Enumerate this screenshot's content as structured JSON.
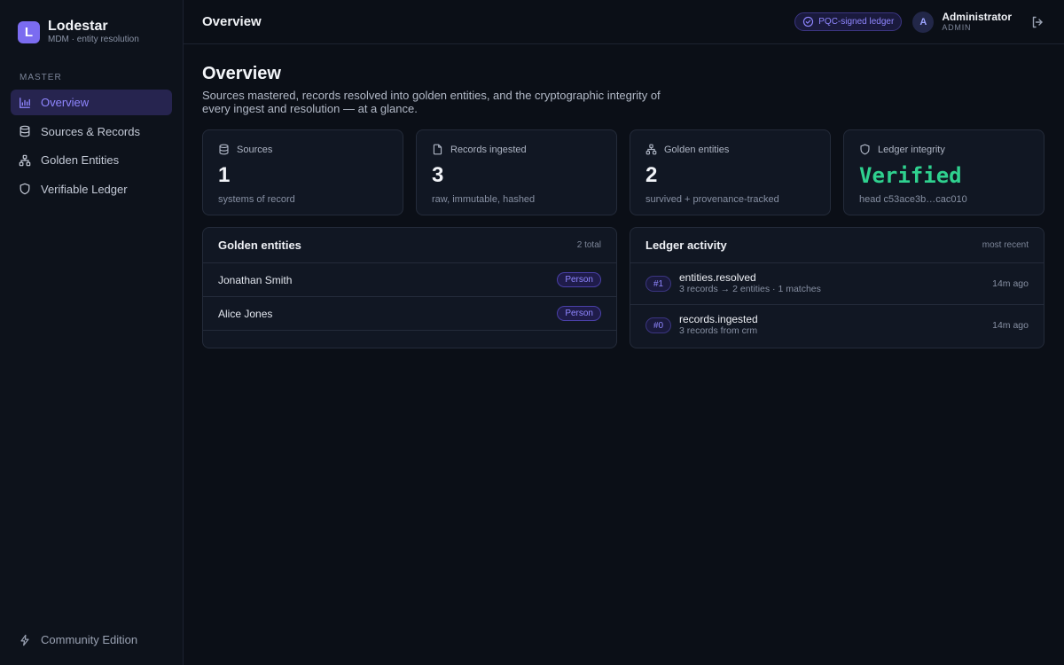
{
  "brand": {
    "logo_letter": "L",
    "name": "Lodestar",
    "subtitle": "MDM · entity resolution"
  },
  "sidebar": {
    "section_label": "MASTER",
    "items": [
      {
        "label": "Overview",
        "icon": "bar-chart-icon",
        "active": true
      },
      {
        "label": "Sources & Records",
        "icon": "database-icon",
        "active": false
      },
      {
        "label": "Golden Entities",
        "icon": "hierarchy-icon",
        "active": false
      },
      {
        "label": "Verifiable Ledger",
        "icon": "shield-icon",
        "active": false
      }
    ],
    "footer_label": "Community Edition",
    "footer_icon": "lightning-icon"
  },
  "topbar": {
    "title": "Overview",
    "badge_label": "PQC-signed ledger",
    "badge_icon": "check-circle-icon",
    "avatar_letter": "A",
    "user_name": "Administrator",
    "user_role": "ADMIN",
    "logout_icon": "logout-icon"
  },
  "page": {
    "title": "Overview",
    "description": "Sources mastered, records resolved into golden entities, and the cryptographic integrity of every ingest and resolution — at a glance."
  },
  "stats": [
    {
      "label": "Sources",
      "icon": "database-icon",
      "value": "1",
      "sub": "systems of record"
    },
    {
      "label": "Records ingested",
      "icon": "file-icon",
      "value": "3",
      "sub": "raw, immutable, hashed"
    },
    {
      "label": "Golden entities",
      "icon": "hierarchy-icon",
      "value": "2",
      "sub": "survived + provenance-tracked"
    },
    {
      "label": "Ledger integrity",
      "icon": "shield-icon",
      "value": "Verified",
      "sub": "head c53ace3b…cac010"
    }
  ],
  "golden_entities": {
    "title": "Golden entities",
    "meta": "2 total",
    "rows": [
      {
        "name": "Jonathan Smith",
        "type": "Person"
      },
      {
        "name": "Alice Jones",
        "type": "Person"
      }
    ]
  },
  "ledger_activity": {
    "title": "Ledger activity",
    "meta": "most recent",
    "rows": [
      {
        "seq": "#1",
        "event": "entities.resolved",
        "detail": "3 records → 2 entities · 1 matches",
        "time": "14m ago"
      },
      {
        "seq": "#0",
        "event": "records.ingested",
        "detail": "3 records from crm",
        "time": "14m ago"
      }
    ]
  },
  "colors": {
    "accent": "#8f86ff",
    "success": "#2fd18f",
    "background": "#0b0f17"
  }
}
